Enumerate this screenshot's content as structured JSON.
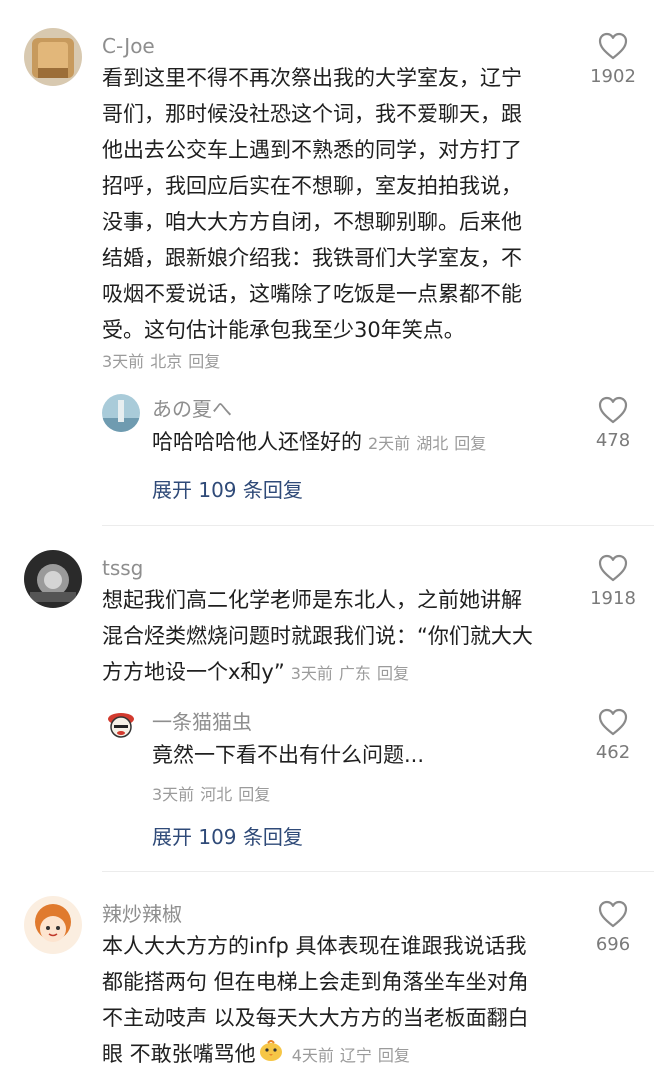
{
  "icons": {
    "like": "heart-outline-icon"
  },
  "comments": [
    {
      "user": "C-Joe",
      "lines": [
        "看到这里不得不再次祭出我的大学室友，辽宁",
        "哥们，那时候没社恐这个词，我不爱聊天，跟",
        "他出去公交车上遇到不熟悉的同学，对方打了",
        "招呼，我回应后实在不想聊，室友拍拍我说，",
        "没事，咱大大方方自闭，不想聊别聊。后来他",
        "结婚，跟新娘介绍我：我铁哥们大学室友，不",
        "吸烟不爱说话，这嘴除了吃饭是一点累都不能",
        "受。这句估计能承包我至少30年笑点。"
      ],
      "time": "3天前",
      "location": "北京",
      "reply": "回复",
      "likes": "1902",
      "sub_reply": {
        "user": "あの夏へ",
        "text": "哈哈哈哈他人还怪好的",
        "time": "2天前",
        "location": "湖北",
        "reply": "回复",
        "likes": "478"
      },
      "expand": "展开 109 条回复"
    },
    {
      "user": "tssg",
      "lines": [
        "想起我们高二化学老师是东北人，之前她讲解",
        "混合烃类燃烧问题时就跟我们说：“你们就大大",
        "方方地设一个x和y”"
      ],
      "time": "3天前",
      "location": "广东",
      "reply": "回复",
      "likes": "1918",
      "sub_reply": {
        "user": "一条猫猫虫",
        "text": "竟然一下看不出有什么问题...",
        "time": "3天前",
        "location": "河北",
        "reply": "回复",
        "likes": "462"
      },
      "expand": "展开 109 条回复"
    },
    {
      "user": "辣炒辣椒",
      "lines": [
        "本人大大方方的infp 具体表现在谁跟我说话我",
        "都能搭两句 但在电梯上会走到角落坐车坐对角",
        "不主动吱声 以及每天大大方方的当老板面翻白",
        "眼 不敢张嘴骂他"
      ],
      "time": "4天前",
      "location": "辽宁",
      "reply": "回复",
      "likes": "696"
    }
  ]
}
